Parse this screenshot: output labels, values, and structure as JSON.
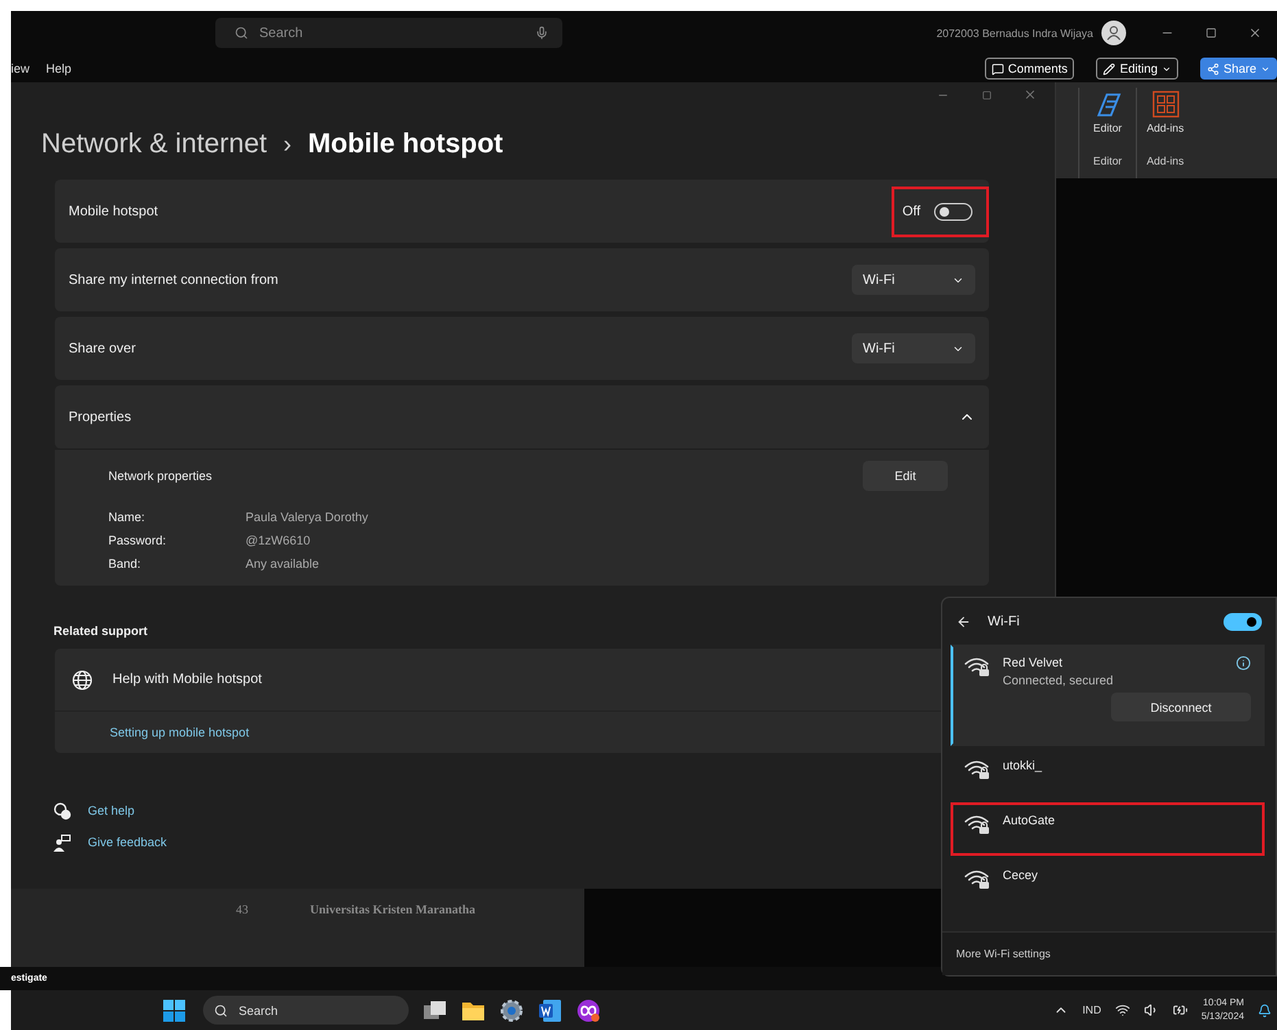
{
  "word": {
    "search_placeholder": "Search",
    "user": "2072003 Bernadus Indra Wijaya",
    "menu": [
      "iew",
      "Help"
    ],
    "buttons": [
      {
        "label": "Comments",
        "kind": "comments"
      },
      {
        "label": "Editing",
        "kind": "editing"
      },
      {
        "label": "Share",
        "kind": "share"
      }
    ],
    "ribbon": [
      {
        "label": "Editor",
        "group": "Editor",
        "kind": "editor"
      },
      {
        "label": "Add-ins",
        "group": "Add-ins",
        "kind": "addins"
      }
    ],
    "page_number": "43",
    "page_footer": "Universitas Kristen Maranatha",
    "status_text": "estigate"
  },
  "settings": {
    "breadcrumb_parent": "Network & internet",
    "breadcrumb_separator": "›",
    "title": "Mobile hotspot",
    "rows": [
      {
        "kind": "toggle",
        "label": "Mobile hotspot",
        "state_text": "Off",
        "on": false,
        "highlighted": true
      },
      {
        "kind": "dropdown",
        "label": "Share my internet connection from",
        "value": "Wi-Fi"
      },
      {
        "kind": "dropdown",
        "label": "Share over",
        "value": "Wi-Fi"
      },
      {
        "kind": "expander",
        "label": "Properties",
        "expanded": true
      }
    ],
    "properties": {
      "heading": "Network properties",
      "button": "Edit",
      "fields": [
        {
          "label": "Name:",
          "value": "Paula Valerya Dorothy"
        },
        {
          "label": "Password:",
          "value": "@1zW6610"
        },
        {
          "label": "Band:",
          "value": "Any available"
        }
      ]
    },
    "related_heading": "Related support",
    "help_item": "Help with Mobile hotspot",
    "help_link": "Setting up mobile hotspot",
    "footer_links": [
      {
        "label": "Get help",
        "kind": "help"
      },
      {
        "label": "Give feedback",
        "kind": "feedback"
      }
    ]
  },
  "wifi_panel": {
    "title": "Wi-Fi",
    "on": true,
    "networks": [
      {
        "name": "Red Velvet",
        "status": "Connected, secured",
        "connected": true,
        "action": "Disconnect",
        "highlighted": false
      },
      {
        "name": "utokki_",
        "connected": false,
        "highlighted": false
      },
      {
        "name": "AutoGate",
        "connected": false,
        "highlighted": true
      },
      {
        "name": "Cecey",
        "connected": false,
        "highlighted": false
      }
    ],
    "more_settings": "More Wi-Fi settings"
  },
  "taskbar": {
    "search": "Search",
    "apps": [
      {
        "kind": "taskview"
      },
      {
        "kind": "folder"
      },
      {
        "kind": "gear"
      },
      {
        "kind": "word"
      },
      {
        "kind": "infinity"
      }
    ],
    "language": "IND",
    "time": "10:04 PM",
    "date": "5/13/2024"
  }
}
